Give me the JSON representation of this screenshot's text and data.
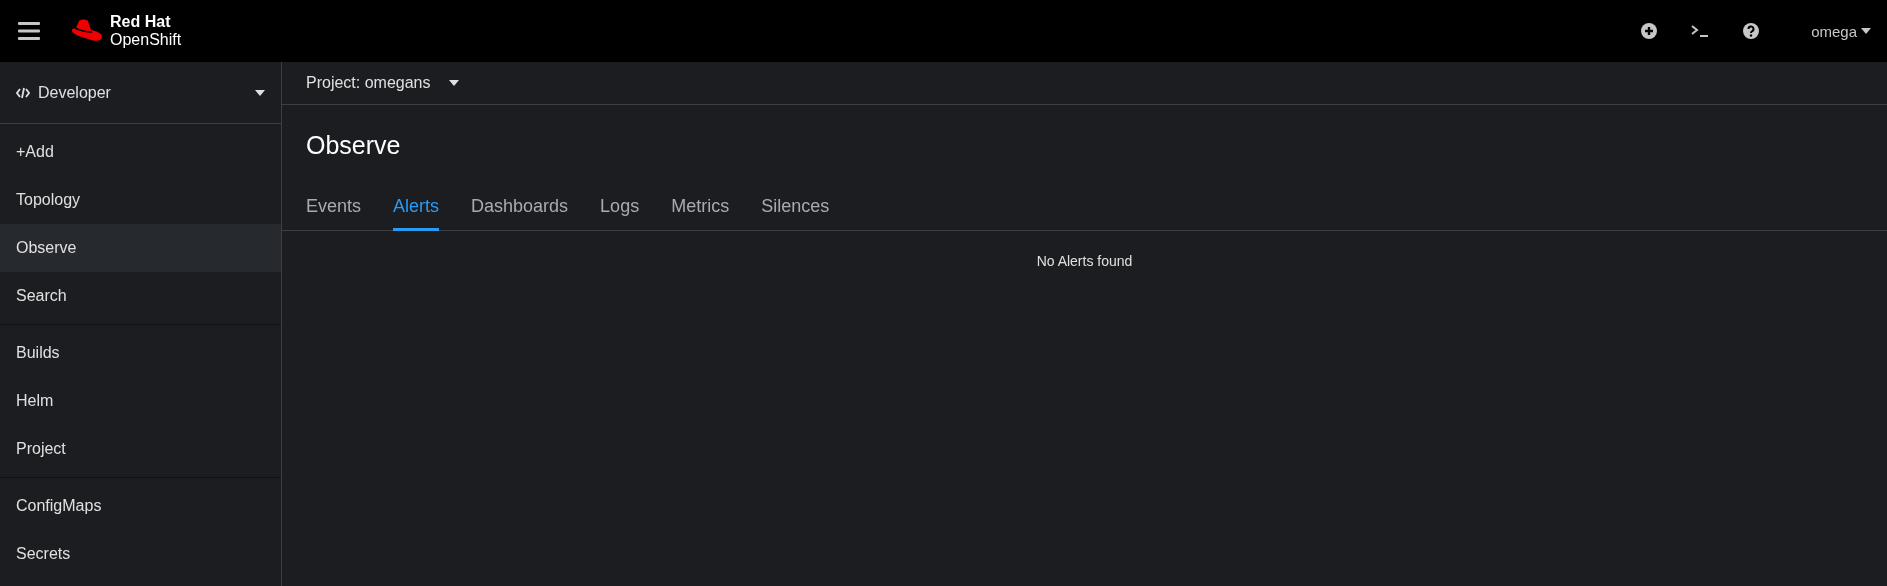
{
  "masthead": {
    "brand_line_1": "Red Hat",
    "brand_line_2": "OpenShift",
    "user": "omega"
  },
  "sidebar": {
    "perspective": "Developer",
    "groups": [
      {
        "items": [
          {
            "label": "+Add",
            "selected": false
          },
          {
            "label": "Topology",
            "selected": false
          },
          {
            "label": "Observe",
            "selected": true
          },
          {
            "label": "Search",
            "selected": false
          }
        ]
      },
      {
        "items": [
          {
            "label": "Builds",
            "selected": false
          },
          {
            "label": "Helm",
            "selected": false
          },
          {
            "label": "Project",
            "selected": false
          }
        ]
      },
      {
        "items": [
          {
            "label": "ConfigMaps",
            "selected": false
          },
          {
            "label": "Secrets",
            "selected": false
          }
        ]
      }
    ]
  },
  "project_selector": "Project: omegans",
  "page_title": "Observe",
  "tabs": [
    {
      "label": "Events",
      "selected": false
    },
    {
      "label": "Alerts",
      "selected": true
    },
    {
      "label": "Dashboards",
      "selected": false
    },
    {
      "label": "Logs",
      "selected": false
    },
    {
      "label": "Metrics",
      "selected": false
    },
    {
      "label": "Silences",
      "selected": false
    }
  ],
  "empty_message": "No Alerts found"
}
